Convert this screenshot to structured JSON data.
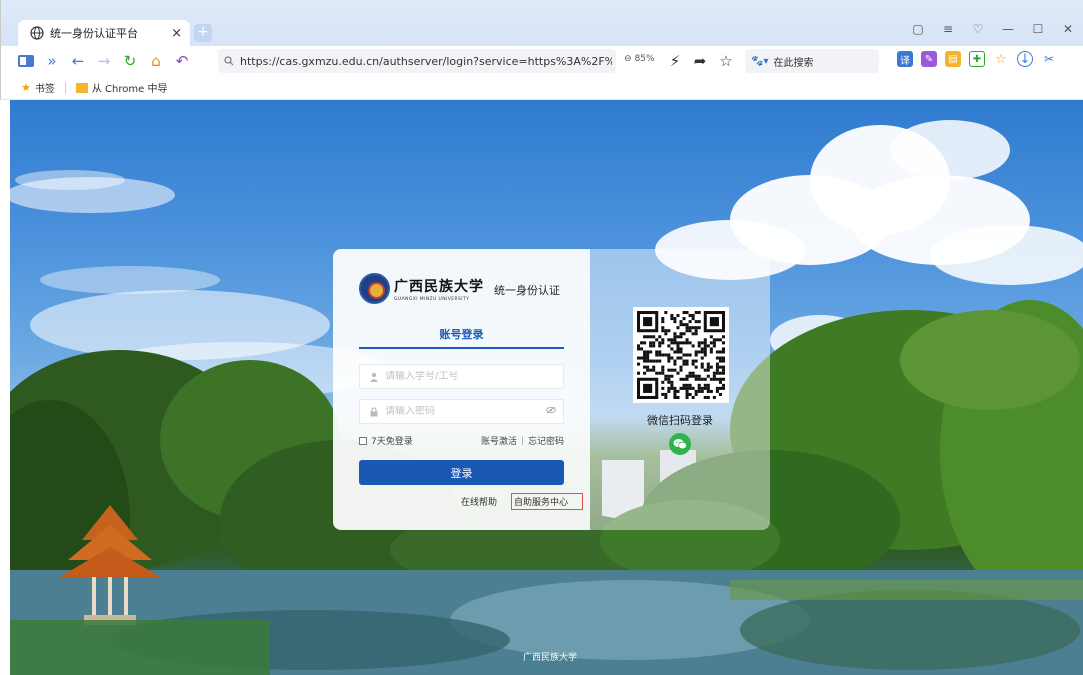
{
  "browser": {
    "tab_title": "统一身份认证平台",
    "tab_close": "×",
    "new_tab": "+",
    "url": "https://cas.gxmzu.edu.cn/authserver/login?service=https%3A%2F%2Fcas.gx",
    "zoom": "85%",
    "search_placeholder": "在此搜索",
    "bookmarks": [
      "书签",
      "从 Chrome 中导"
    ]
  },
  "login": {
    "school_name_cn": "广西民族大学",
    "school_name_en": "GUANGXI MINZU UNIVERSITY",
    "system_title": "统一身份认证",
    "tab_label": "账号登录",
    "username_placeholder": "请输入学号/工号",
    "password_placeholder": "请输入密码",
    "remember_label": "7天免登录",
    "activate_link": "账号激活",
    "forgot_link": "忘记密码",
    "login_button": "登录",
    "help_link": "在线帮助",
    "self_service_link": "自助服务中心"
  },
  "wechat": {
    "scan_text": "微信扫码登录"
  },
  "footer": {
    "text": "广西民族大学"
  }
}
